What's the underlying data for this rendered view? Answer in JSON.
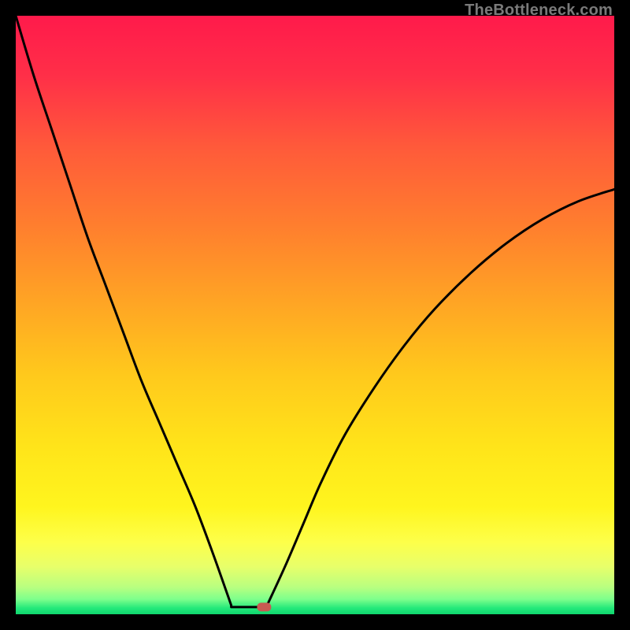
{
  "watermark": "TheBottleneck.com",
  "accent_marker_color": "#c85a52",
  "curve_color": "#000000",
  "gradient_stops": [
    {
      "offset": 0.0,
      "color": "#ff1a4b"
    },
    {
      "offset": 0.1,
      "color": "#ff2f48"
    },
    {
      "offset": 0.22,
      "color": "#ff5a3a"
    },
    {
      "offset": 0.35,
      "color": "#ff7e2e"
    },
    {
      "offset": 0.48,
      "color": "#ffa524"
    },
    {
      "offset": 0.6,
      "color": "#ffc91c"
    },
    {
      "offset": 0.72,
      "color": "#ffe41a"
    },
    {
      "offset": 0.82,
      "color": "#fff51e"
    },
    {
      "offset": 0.88,
      "color": "#fdff4a"
    },
    {
      "offset": 0.92,
      "color": "#e8ff6a"
    },
    {
      "offset": 0.955,
      "color": "#b8ff80"
    },
    {
      "offset": 0.975,
      "color": "#7dff8c"
    },
    {
      "offset": 0.99,
      "color": "#22e87a"
    },
    {
      "offset": 1.0,
      "color": "#10d66e"
    }
  ],
  "chart_data": {
    "type": "line",
    "title": "",
    "xlabel": "",
    "ylabel": "",
    "xlim": [
      0,
      100
    ],
    "ylim": [
      0,
      100
    ],
    "notch_x": 40,
    "flat_bottom": {
      "x_start": 36,
      "x_end": 42,
      "y": 1.2
    },
    "marker": {
      "x": 41.5,
      "y": 1.2
    },
    "series": [
      {
        "name": "left-branch",
        "x": [
          0,
          3,
          6,
          9,
          12,
          15,
          18,
          21,
          24,
          27,
          30,
          33,
          36
        ],
        "y": [
          100,
          90,
          81,
          72,
          63,
          55,
          47,
          39,
          32,
          25,
          18,
          10,
          1.5
        ]
      },
      {
        "name": "right-branch",
        "x": [
          42,
          45,
          48,
          51,
          55,
          60,
          65,
          70,
          76,
          82,
          88,
          94,
          100
        ],
        "y": [
          1.5,
          8,
          15,
          22,
          30,
          38,
          45,
          51,
          57,
          62,
          66,
          69,
          71
        ]
      }
    ]
  }
}
